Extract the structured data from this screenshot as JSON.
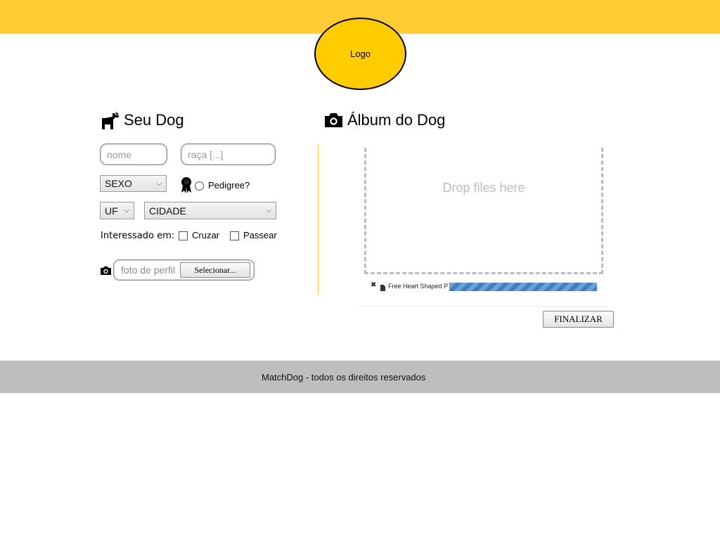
{
  "header": {
    "logo_label": "Logo",
    "bar_color": "#ffcc33",
    "logo_color": "#ffcc00"
  },
  "dog_section": {
    "title": "Seu Dog",
    "icon": "dog-icon",
    "name_placeholder": "nome",
    "breed_placeholder": "raça [...]",
    "sex_select": "SEXO",
    "pedigree_icon": "award-ribbon-icon",
    "pedigree_label": "Pedigree?",
    "uf_select": "UF",
    "city_select": "CIDADE",
    "interest_label": "Interessado em:",
    "interest_options": [
      "Cruzar",
      "Passear"
    ],
    "photo_icon": "camera-icon",
    "photo_placeholder": "foto de perfil",
    "photo_button": "Selecionar..."
  },
  "album_section": {
    "title": "Álbum do Dog",
    "icon": "camera-icon",
    "dropzone_text": "Drop files here",
    "file_name": "Free Heart Shaped P",
    "upload_progress": 1.0,
    "finalize_button": "FINALIZAR"
  },
  "footer": {
    "text": "MatchDog - todos os direitos reservados"
  }
}
